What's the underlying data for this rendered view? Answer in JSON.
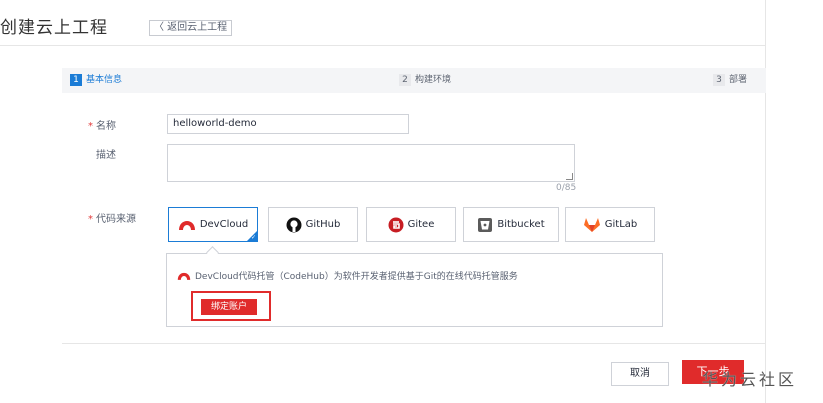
{
  "header": {
    "title": "创建云上工程",
    "back_link": "〈 返回云上工程"
  },
  "steps": [
    {
      "num": "1",
      "label": "基本信息",
      "active": true
    },
    {
      "num": "2",
      "label": "构建环境",
      "active": false
    },
    {
      "num": "3",
      "label": "部署",
      "active": false
    }
  ],
  "form": {
    "required_mark": "*",
    "name_label": "名称",
    "name_value": "helloworld-demo",
    "desc_label": "描述",
    "desc_count": "0/85",
    "source_label": "代码来源"
  },
  "sources": [
    {
      "label": "DevCloud",
      "icon": "devcloud-icon",
      "selected": true
    },
    {
      "label": "GitHub",
      "icon": "github-icon",
      "selected": false
    },
    {
      "label": "Gitee",
      "icon": "gitee-icon",
      "selected": false
    },
    {
      "label": "Bitbucket",
      "icon": "bitbucket-icon",
      "selected": false
    },
    {
      "label": "GitLab",
      "icon": "gitlab-icon",
      "selected": false
    }
  ],
  "panel": {
    "description": "DevCloud代码托管（CodeHub）为软件开发者提供基于Git的在线代码托管服务",
    "bind_button": "绑定账户"
  },
  "footer": {
    "cancel": "取消",
    "next": "下一步"
  },
  "watermark": "华为云社区",
  "colors": {
    "accent_blue": "#1b7cd6",
    "accent_red": "#e02b2b"
  }
}
